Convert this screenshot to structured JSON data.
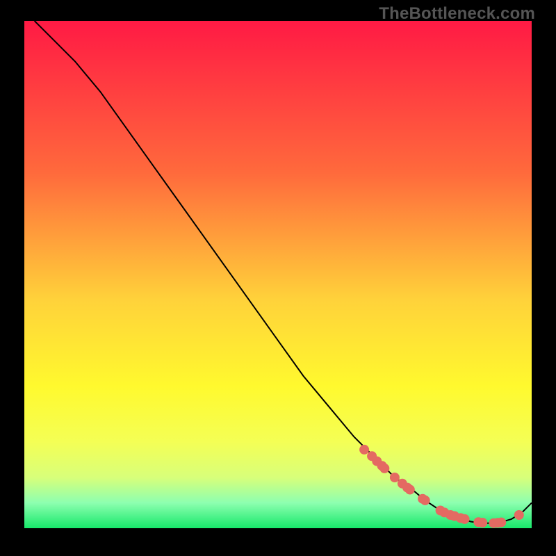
{
  "watermark": "TheBottleneck.com",
  "colors": {
    "grad_top": "#ff1a44",
    "grad_mid1": "#ff6a3c",
    "grad_mid2": "#ffd23a",
    "grad_mid3": "#fff92e",
    "grad_mid4": "#f4ff55",
    "grad_mid5": "#d8ff7a",
    "grad_mid6": "#8dffb0",
    "grad_bottom": "#17e86a",
    "curve": "#000000",
    "marker": "#e46a62"
  },
  "chart_data": {
    "type": "line",
    "title": "",
    "xlabel": "",
    "ylabel": "",
    "xlim": [
      0,
      100
    ],
    "ylim": [
      0,
      100
    ],
    "series": [
      {
        "name": "curve",
        "x": [
          2,
          6,
          10,
          15,
          20,
          25,
          30,
          35,
          40,
          45,
          50,
          55,
          60,
          65,
          70,
          73,
          76,
          79,
          82,
          85,
          88,
          90,
          92,
          94,
          96,
          98,
          100
        ],
        "y": [
          100,
          96,
          92,
          86,
          79,
          72,
          65,
          58,
          51,
          44,
          37,
          30,
          24,
          18,
          13,
          10,
          8,
          5.5,
          3.5,
          2.2,
          1.3,
          1.0,
          1.0,
          1.2,
          1.8,
          3.0,
          5.0
        ]
      }
    ],
    "markers": {
      "name": "dots",
      "x": [
        67,
        68.5,
        69.5,
        70.5,
        71,
        73,
        74.5,
        75.5,
        76,
        78.5,
        79,
        82,
        82.8,
        84,
        84.8,
        86,
        86.8,
        89.5,
        90.3,
        92.5,
        93.3,
        94,
        97.5
      ],
      "y": [
        15.5,
        14.2,
        13.2,
        12.3,
        11.8,
        10.0,
        8.8,
        8.0,
        7.6,
        5.8,
        5.5,
        3.5,
        3.1,
        2.6,
        2.4,
        2.0,
        1.8,
        1.2,
        1.1,
        1.0,
        1.05,
        1.15,
        2.6
      ]
    }
  }
}
